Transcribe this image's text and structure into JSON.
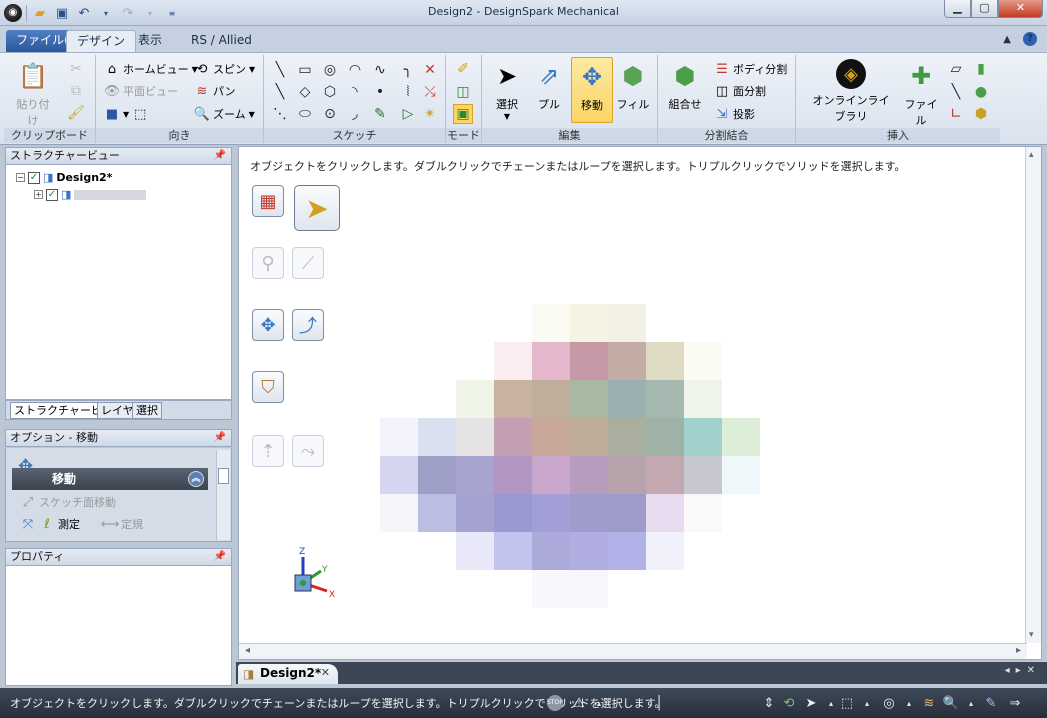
{
  "window": {
    "title": "Design2 - DesignSpark Mechanical"
  },
  "tabs": {
    "file": "ファイル(F)",
    "design": "デザイン",
    "view": "表示",
    "rs": "RS / Allied"
  },
  "ribbon": {
    "clipboard": {
      "label": "クリップボード",
      "paste": "貼り付け"
    },
    "orient": {
      "label": "向き",
      "home": "ホームビュー",
      "plane": "平面ビュー",
      "spin": "スピン",
      "pan": "パン",
      "zoom": "ズーム"
    },
    "sketch": {
      "label": "スケッチ"
    },
    "mode": {
      "label": "モード"
    },
    "edit": {
      "label": "編集",
      "select": "選択",
      "pull": "プル",
      "move": "移動",
      "fill": "フィル"
    },
    "intersect": {
      "label": "分割結合",
      "combine": "組合せ",
      "split_body": "ボディ分割",
      "split_face": "面分割",
      "project": "投影"
    },
    "insert": {
      "label": "挿入",
      "online_library": "オンラインライブラリ",
      "file": "ファイル"
    }
  },
  "structure_panel": {
    "title": "ストラクチャービュー",
    "root": "Design2*",
    "child": "",
    "tabs": [
      "ストラクチャービュー",
      "レイヤ",
      "選択"
    ]
  },
  "options_panel": {
    "title": "オプション - 移動",
    "header": "移動",
    "item_sketch_move": "スケッチ面移動",
    "item_measure": "測定",
    "item_fixed": "定規"
  },
  "properties_panel": {
    "title": "プロパティ"
  },
  "canvas": {
    "hint": "オブジェクトをクリックします。ダブルクリックでチェーンまたはループを選択します。トリプルクリックでソリッドを選択します。",
    "triad": {
      "z": "Z",
      "y": "Y",
      "x": "X"
    }
  },
  "doc_tab": {
    "label": "Design2*"
  },
  "status": {
    "text": "オブジェクトをクリックします。ダブルクリックでチェーンまたはループを選択します。トリプルクリックでソリッドを選択します。"
  },
  "icons": {
    "stop": "stop-icon",
    "warning": "warning-icon",
    "select": "cursor-icon"
  }
}
